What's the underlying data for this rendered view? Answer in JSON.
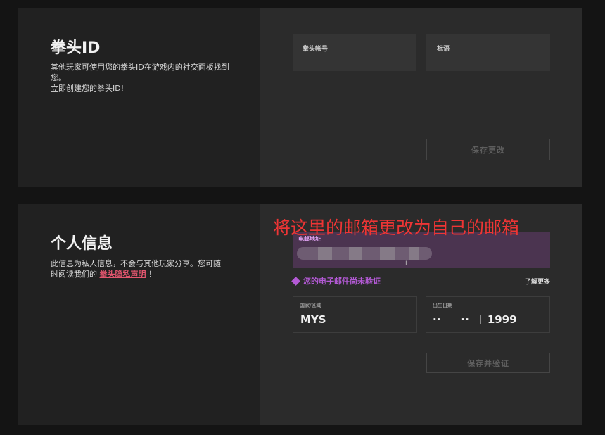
{
  "riot_id": {
    "title": "拳头ID",
    "description_1": "其他玩家可使用您的拳头ID在游戏内的社交面板找到您。",
    "description_2": "立即创建您的拳头ID!",
    "account_label": "拳头帐号",
    "tag_label": "标语",
    "save_button": "保存更改"
  },
  "personal_info": {
    "title": "个人信息",
    "description": "此信息为私人信息，不会与其他玩家分享。您可随时阅读我们的",
    "privacy_link": "拳头隐私声明",
    "description_end": "！",
    "email_label": "电邮地址",
    "email_warning": "您的电子邮件尚未验证",
    "learn_more": "了解更多",
    "country_label": "国家/区域",
    "country_value": "MYS",
    "dob_label": "出生日期",
    "dob_day": "··",
    "dob_month": "··",
    "dob_year": "1999",
    "save_button": "保存并验证"
  },
  "annotation": {
    "text": "将这里的邮箱更改为自己的邮箱",
    "color": "#ee3535"
  },
  "colors": {
    "accent_purple": "#b45ad6",
    "link_red": "#e4566f"
  }
}
